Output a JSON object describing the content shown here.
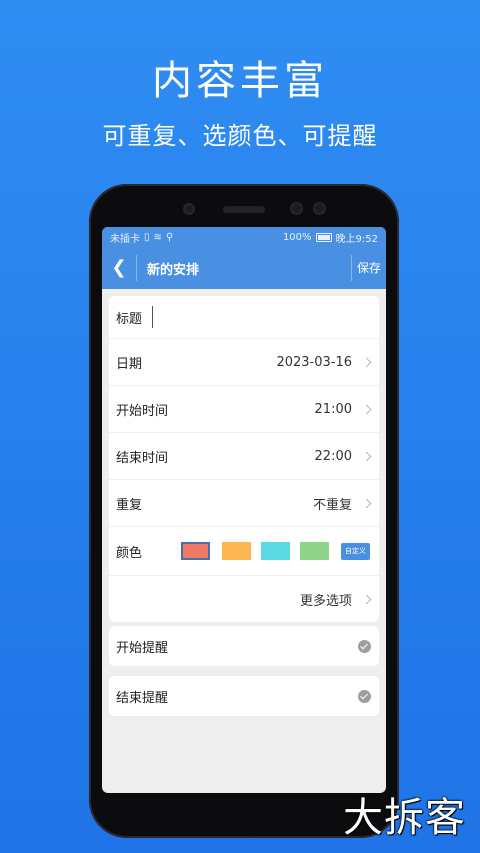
{
  "promo": {
    "title": "内容丰富",
    "subtitle": "可重复、选颜色、可提醒"
  },
  "statusbar": {
    "carrier": "未插卡",
    "battery": "100%",
    "time": "晚上9:52"
  },
  "appbar": {
    "back_glyph": "❮",
    "title": "新的安排",
    "save_label": "保存"
  },
  "form": {
    "title_label": "标题",
    "title_value": "",
    "date_label": "日期",
    "date_value": "2023-03-16",
    "start_label": "开始时间",
    "start_value": "21:00",
    "end_label": "结束时间",
    "end_value": "22:00",
    "repeat_label": "重复",
    "repeat_value": "不重复",
    "color_label": "颜色",
    "colors": [
      "#f07a66",
      "#fcb651",
      "#5bd9e3",
      "#8fd48a"
    ],
    "selected_color": "#f07a66",
    "custom_label": "自定义",
    "more_label": "更多选项"
  },
  "reminders": {
    "start_label": "开始提醒",
    "end_label": "结束提醒"
  },
  "watermark": "大拆客"
}
